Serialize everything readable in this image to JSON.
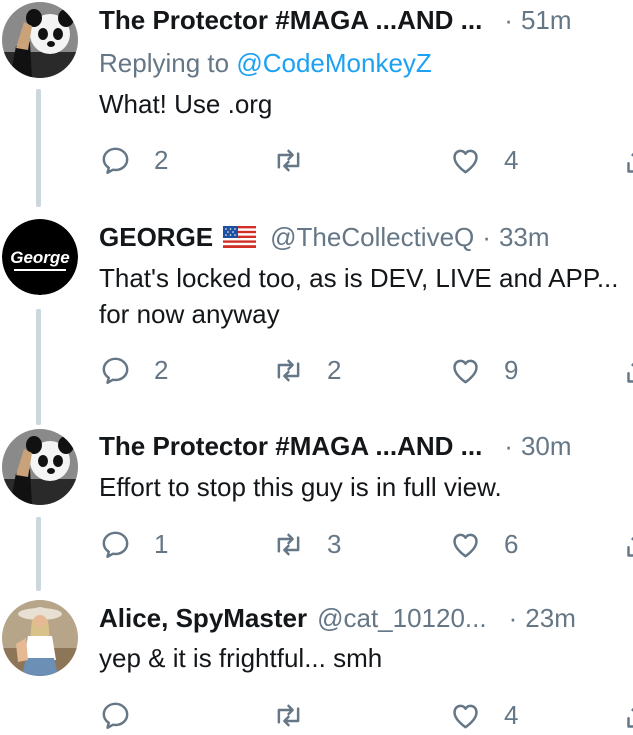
{
  "tweets": [
    {
      "name": "The Protector #MAGA ...AND ...",
      "handle": "",
      "time": "51m",
      "dot": "·",
      "replying_prefix": "Replying to ",
      "replying_to": "@CodeMonkeyZ",
      "text": "What! Use .org",
      "replies": "2",
      "retweets": "",
      "likes": "4",
      "avatar": "panda-head-avatar"
    },
    {
      "name": "GEORGE",
      "flag": "us-flag-icon",
      "handle": "@TheCollectiveQ",
      "time": "33m",
      "dot": "·",
      "text": "That's locked too, as is DEV, LIVE and APP...\nfor now anyway",
      "replies": "2",
      "retweets": "2",
      "likes": "9",
      "avatar": "george-logo-avatar",
      "avatar_text": "George"
    },
    {
      "name": "The Protector #MAGA ...AND ...",
      "handle": "",
      "time": "30m",
      "dot": "·",
      "text": "Effort to stop this guy is in full view.",
      "replies": "1",
      "retweets": "3",
      "likes": "6",
      "avatar": "panda-head-avatar"
    },
    {
      "name": "Alice, SpyMaster",
      "handle": "@cat_10120...",
      "time": "23m",
      "dot": "·",
      "text": "yep & it is frightful... smh",
      "replies": "",
      "retweets": "",
      "likes": "4",
      "avatar": "cowgirl-photo-avatar"
    }
  ],
  "colors": {
    "text": "#14171a",
    "secondary": "#657786",
    "link": "#1da1f2",
    "thread_line": "#ccd6dd"
  }
}
